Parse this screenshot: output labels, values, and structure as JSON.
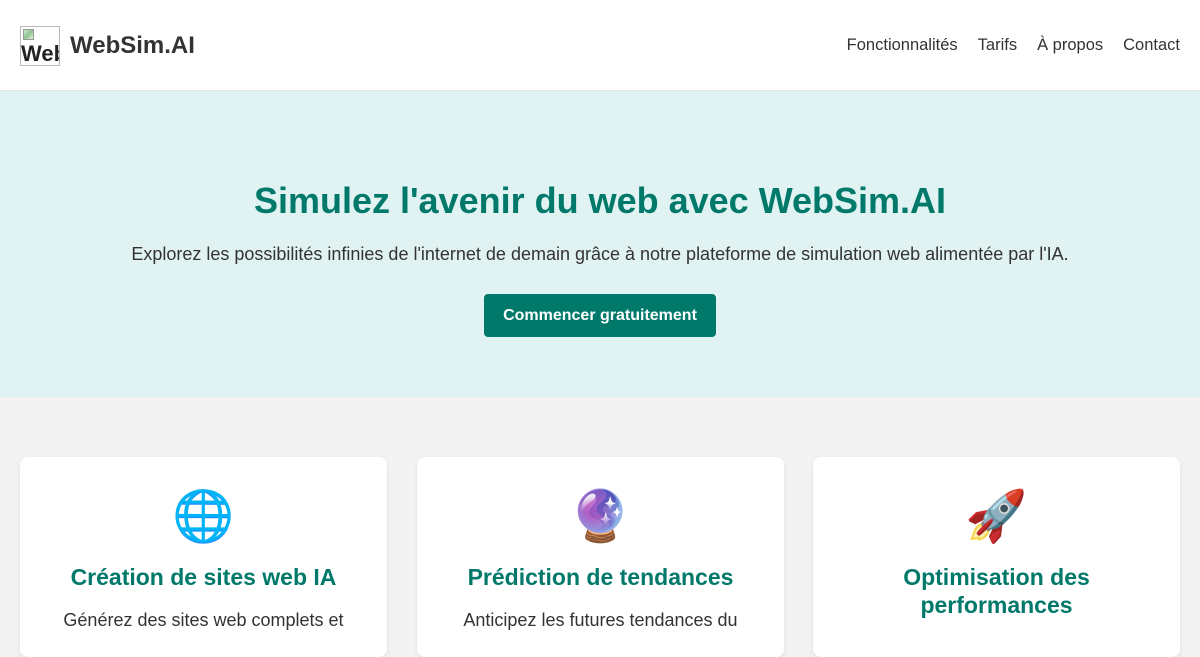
{
  "header": {
    "logo_alt": "WebSim.AI",
    "brand": "WebSim.AI",
    "nav": [
      "Fonctionnalités",
      "Tarifs",
      "À propos",
      "Contact"
    ]
  },
  "hero": {
    "title": "Simulez l'avenir du web avec WebSim.AI",
    "subtitle": "Explorez les possibilités infinies de l'internet de demain grâce à notre plateforme de simulation web alimentée par l'IA.",
    "cta": "Commencer gratuitement"
  },
  "features": [
    {
      "icon": "globe-icon",
      "glyph": "🌐",
      "title": "Création de sites web IA",
      "desc": "Générez des sites web complets et"
    },
    {
      "icon": "crystal-ball-icon",
      "glyph": "🔮",
      "title": "Prédiction de tendances",
      "desc": "Anticipez les futures tendances du"
    },
    {
      "icon": "rocket-icon",
      "glyph": "🚀",
      "title": "Optimisation des performances",
      "desc": ""
    }
  ],
  "colors": {
    "accent": "#00796b",
    "hero_bg": "#e0f2f1",
    "page_bg": "#f3f3f3"
  }
}
